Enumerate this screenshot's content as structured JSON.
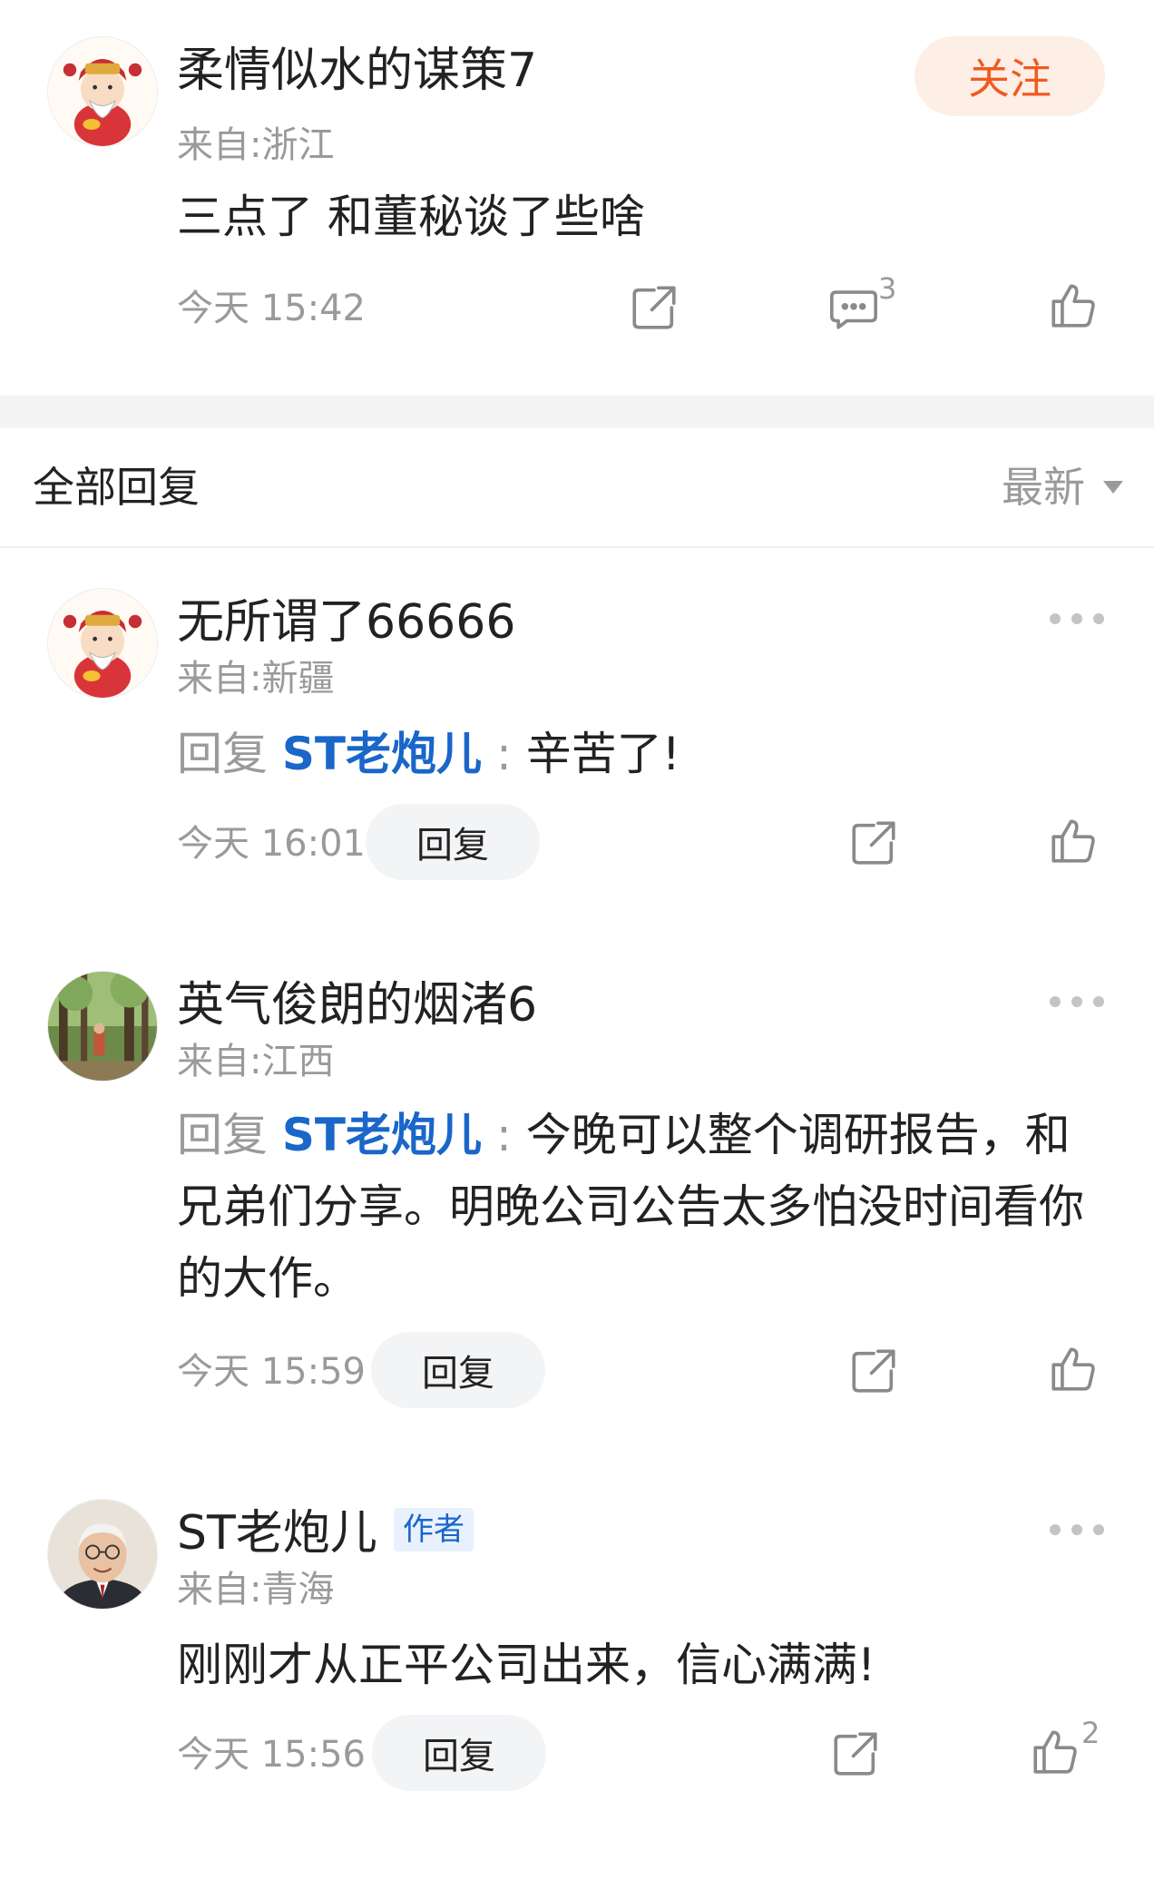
{
  "post": {
    "username": "柔情似水的谋策7",
    "location": "来自:浙江",
    "content": "三点了 和董秘谈了些啥",
    "time": "今天 15:42",
    "comment_count": "3",
    "follow_label": "关注"
  },
  "replies_header": {
    "title": "全部回复",
    "sort_label": "最新"
  },
  "replies": [
    {
      "username": "无所谓了66666",
      "location": "来自:新疆",
      "reply_prefix": "回复",
      "mention": "ST老炮儿",
      "colon": ":",
      "text": "辛苦了!",
      "time": "今天 16:01",
      "reply_label": "回复"
    },
    {
      "username": "英气俊朗的烟渚6",
      "location": "来自:江西",
      "reply_prefix": "回复",
      "mention": "ST老炮儿",
      "colon": ":",
      "text": "今晚可以整个调研报告，和兄弟们分享。明晚公司公告太多怕没时间看你的大作。",
      "time": "今天 15:59",
      "reply_label": "回复"
    },
    {
      "username": "ST老炮儿",
      "author_tag": "作者",
      "location": "来自:青海",
      "text": "刚刚才从正平公司出来，信心满满!",
      "time": "今天 15:56",
      "reply_label": "回复",
      "like_count": "2"
    }
  ],
  "icons": {
    "share": "share-icon",
    "comment": "comment-icon",
    "like": "thumbs-up-icon",
    "more": "more-icon",
    "sort": "triangle-down-icon"
  },
  "colors": {
    "accent_orange": "#f05a22",
    "follow_bg": "#fdeee6",
    "mention_blue": "#1a66c9",
    "muted_gray": "#9a9a9a"
  }
}
